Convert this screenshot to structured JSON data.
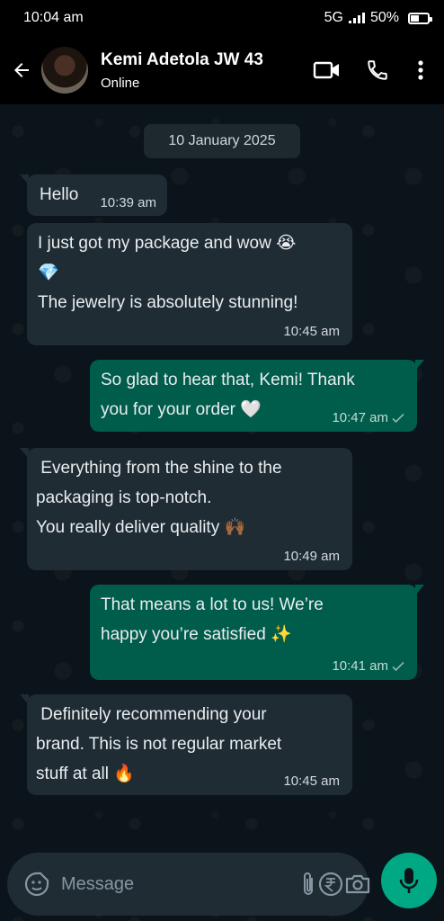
{
  "status_bar": {
    "time": "10:04 am",
    "network": "5G",
    "battery": "50%"
  },
  "header": {
    "contact_name": "Kemi Adetola JW 43",
    "contact_status": "Online",
    "icons": [
      "back-arrow-icon",
      "video-call-icon",
      "phone-icon",
      "more-options-icon"
    ]
  },
  "chat": {
    "date_chip": "10 January 2025",
    "messages": [
      {
        "direction": "in",
        "lines": "Hello",
        "time": "10:39 am"
      },
      {
        "direction": "in",
        "lines": "I just got my package and wow 😭\n💎\nThe jewelry is absolutely stunning!",
        "time": "10:45 am"
      },
      {
        "direction": "out",
        "lines": "So glad to hear that, Kemi! Thank\nyou for your order 🤍",
        "time": "10:47 am",
        "status": "sent"
      },
      {
        "direction": "in",
        "lines": " Everything from the shine to the\npackaging is top-notch.\nYou really deliver quality 🙌🏾",
        "time": "10:49 am"
      },
      {
        "direction": "out",
        "lines": "That means a lot to us! We’re\nhappy you’re satisfied ✨",
        "time": "10:41 am",
        "status": "sent"
      },
      {
        "direction": "in",
        "lines": " Definitely recommending your\nbrand. This is not regular market\nstuff at all 🔥",
        "time": "10:45 am"
      }
    ]
  },
  "composer": {
    "placeholder": "Message",
    "icons": [
      "sticker-icon",
      "attach-icon",
      "rupee-payment-icon",
      "camera-icon",
      "microphone-icon"
    ]
  },
  "colors": {
    "background": "#0b141a",
    "incoming_bubble": "#1f2c34",
    "outgoing_bubble": "#005c4b",
    "accent_green": "#00a884"
  }
}
